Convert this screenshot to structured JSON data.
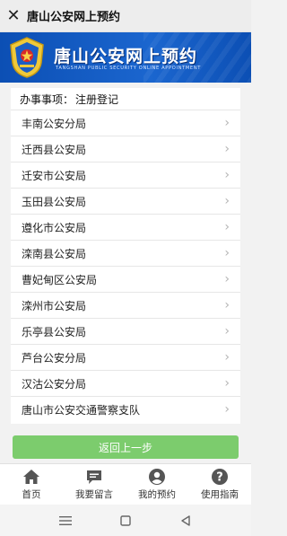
{
  "topbar": {
    "close_icon": "close-icon",
    "title": "唐山公安网上预约"
  },
  "banner": {
    "title": "唐山公安网上预约",
    "subtitle": "TANGSHAN PUBLIC SECURITY ONLINE APPOINTMENT",
    "emblem_icon": "police-emblem-icon"
  },
  "content": {
    "header_label": "办事事项：",
    "header_value": "注册登记",
    "items": [
      {
        "label": "丰南公安分局"
      },
      {
        "label": "迁西县公安局"
      },
      {
        "label": "迁安市公安局"
      },
      {
        "label": "玉田县公安局"
      },
      {
        "label": "遵化市公安局"
      },
      {
        "label": "滦南县公安局"
      },
      {
        "label": "曹妃甸区公安局"
      },
      {
        "label": "滦州市公安局"
      },
      {
        "label": "乐亭县公安局"
      },
      {
        "label": "芦台公安分局"
      },
      {
        "label": "汉沽公安分局"
      },
      {
        "label": "唐山市公安交通警察支队"
      }
    ]
  },
  "back_button": "返回上一步",
  "bottom_nav": [
    {
      "label": "首页",
      "icon": "home-icon"
    },
    {
      "label": "我要留言",
      "icon": "message-icon"
    },
    {
      "label": "我的预约",
      "icon": "user-icon"
    },
    {
      "label": "使用指南",
      "icon": "help-icon"
    }
  ],
  "system_nav": {
    "menu_icon": "menu-icon",
    "home_icon": "home-square-icon",
    "back_icon": "back-triangle-icon"
  },
  "colors": {
    "banner_blue": "#1b66cf",
    "button_green": "#7ccc6d",
    "nav_icon_gray": "#555555"
  }
}
